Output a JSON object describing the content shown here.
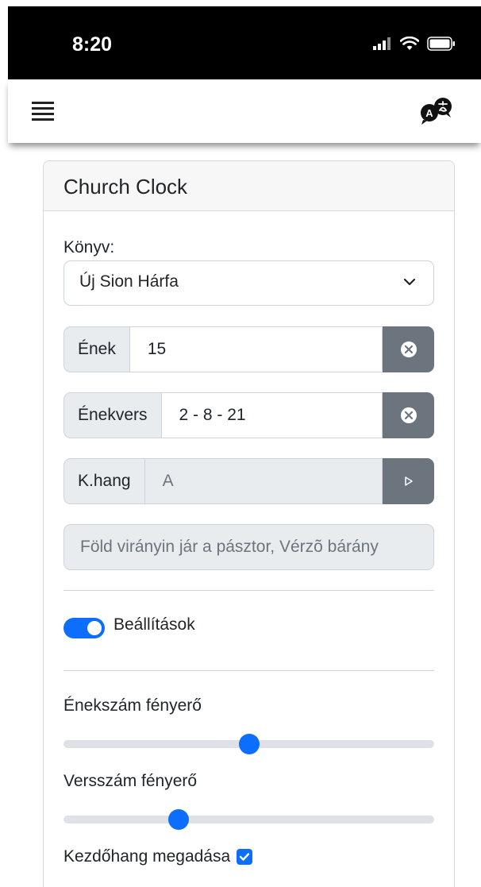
{
  "status_bar": {
    "time": "8:20"
  },
  "card": {
    "title": "Church Clock",
    "book_label": "Könyv:",
    "book_selected": "Új Sion Hárfa",
    "hymn": {
      "label": "Ének",
      "value": "15"
    },
    "verses": {
      "label": "Énekvers",
      "value": "2 - 8 - 21"
    },
    "key": {
      "label": "K.hang",
      "value": "A"
    },
    "hymn_title": "Föld virányin jár a pásztor, Vérzõ bárány",
    "settings_label": "Beállítások",
    "settings_on": true,
    "hymn_brightness_label": "Énekszám fényerő",
    "hymn_brightness": 0.5,
    "verse_brightness_label": "Versszám fényerő",
    "verse_brightness": 0.31,
    "start_key_label": "Kezdőhang megadása",
    "start_key_checked": true
  },
  "colors": {
    "accent": "#0d6efd",
    "button_gray": "#6c757d",
    "field_gray": "#e9ecef"
  }
}
